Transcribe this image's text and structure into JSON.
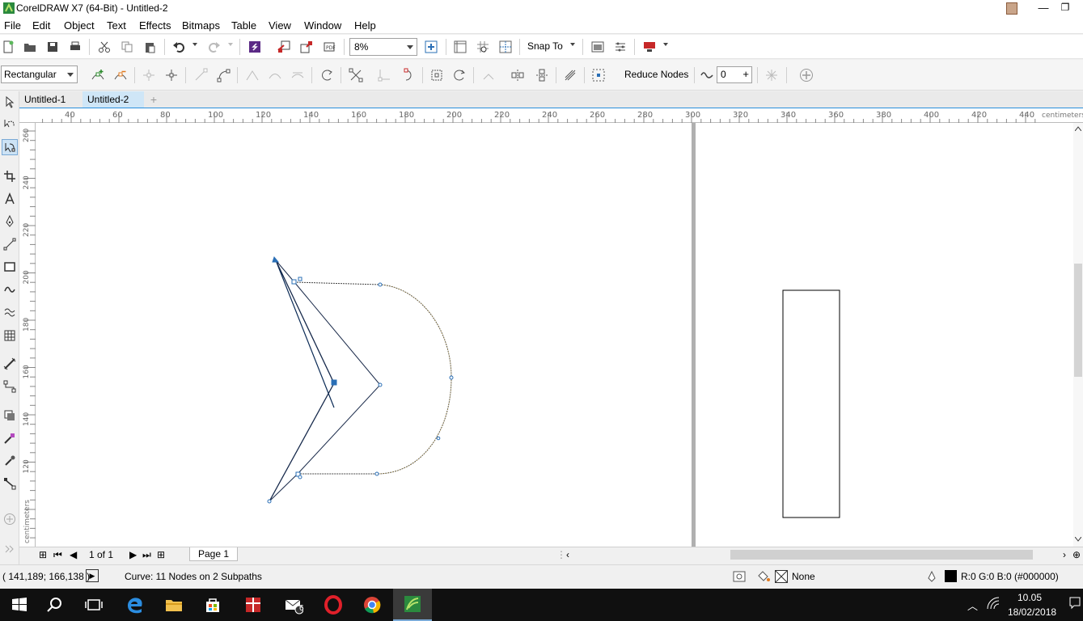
{
  "titlebar": {
    "title": "CorelDRAW X7 (64-Bit) - Untitled-2"
  },
  "menu": [
    "File",
    "Edit",
    "Object",
    "Text",
    "Effects",
    "Bitmaps",
    "Table",
    "View",
    "Window",
    "Help"
  ],
  "toolbar": {
    "zoom_value": "8%",
    "snap_to_label": "Snap To"
  },
  "propbar": {
    "curve_mode": "Rectangular",
    "reduce_nodes_label": "Reduce Nodes",
    "smoothness_value": "0"
  },
  "doc_tabs": [
    "Untitled-1",
    "Untitled-2"
  ],
  "active_doc_tab": "Untitled-2",
  "rulers": {
    "unit": "centimeters",
    "h_ticks": [
      "40",
      "60",
      "80",
      "100",
      "120",
      "140",
      "160",
      "180",
      "200",
      "220",
      "240",
      "260",
      "280",
      "300",
      "320",
      "340",
      "360",
      "380",
      "400",
      "420",
      "440"
    ],
    "v_ticks": [
      "260",
      "240",
      "220",
      "200",
      "180",
      "160",
      "140",
      "120"
    ]
  },
  "page_nav": {
    "counter": "1 of 1",
    "page_tab": "Page 1"
  },
  "status": {
    "cursor_position": "( 141,189; 166,138 )",
    "selection_info": "Curve: 11 Nodes on 2 Subpaths",
    "fill_label": "None",
    "outline_color": "R:0 G:0 B:0 (#000000)"
  },
  "taskbar": {
    "time": "10.05",
    "date": "18/02/2018",
    "mail_badge": "6"
  },
  "colors": {
    "accent": "#2a8fdc",
    "tab_active": "#cfe6f7",
    "node_blue": "#2a6fb6",
    "taskbar": "#101010"
  }
}
